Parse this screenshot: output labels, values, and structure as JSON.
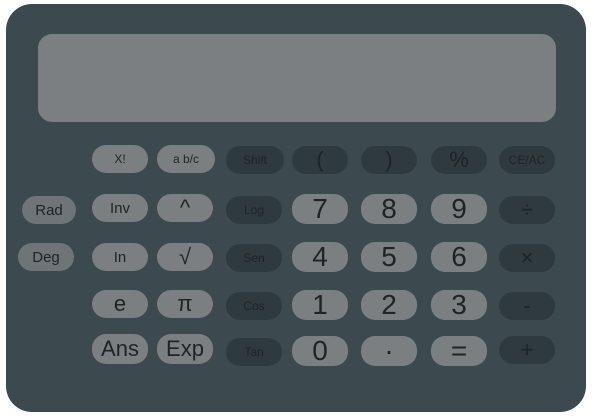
{
  "side_buttons": {
    "rad": "Rad",
    "deg": "Deg"
  },
  "keys": {
    "fact": "X!",
    "frac": "a b/c",
    "shift": "Shift",
    "lparen": "(",
    "rparen": ")",
    "percent": "%",
    "ceac": "CE/AC",
    "inv": "Inv",
    "pow": "^",
    "log": "Log",
    "seven": "7",
    "eight": "8",
    "nine": "9",
    "div": "÷",
    "ln": "In",
    "sqrt": "√",
    "sin": "Sen",
    "four": "4",
    "five": "5",
    "six": "6",
    "mul": "×",
    "e": "e",
    "pi": "π",
    "cos": "Cos",
    "one": "1",
    "two": "2",
    "three": "3",
    "minus": "-",
    "ans": "Ans",
    "exp": "Exp",
    "tan": "Tan",
    "zero": "0",
    "dot": "·",
    "equals": "=",
    "plus": "+"
  },
  "colors": {
    "body": "#3c494e",
    "display": "#7b7f82",
    "key_light": "#7b7f82",
    "key_dark": "#2f3a3f"
  }
}
